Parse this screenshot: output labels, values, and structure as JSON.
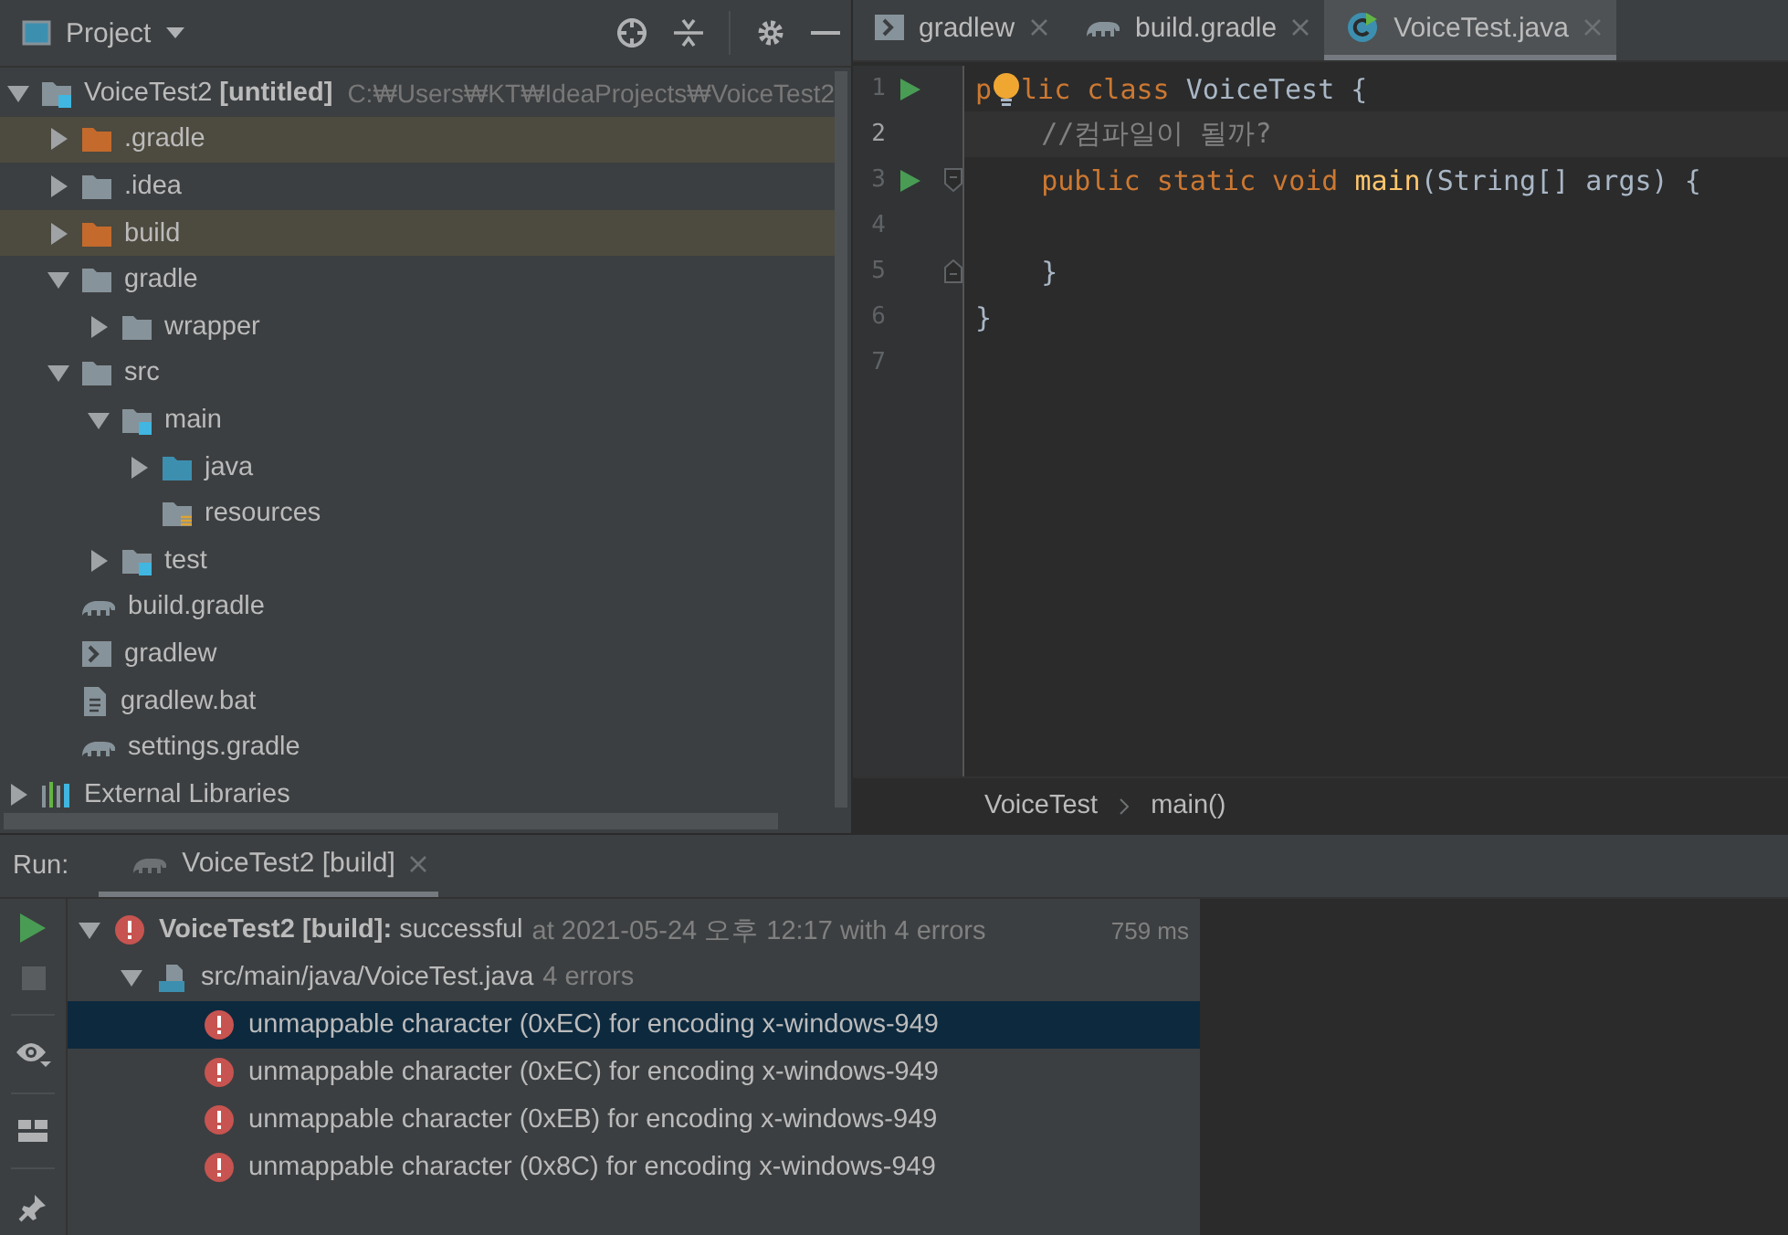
{
  "project_panel": {
    "title": "Project",
    "tree": [
      {
        "label": "VoiceTest2 **[untitled]**",
        "path": "C:₩Users₩KT₩IdeaProjects₩VoiceTest2",
        "kind": "module",
        "expanded": true,
        "children": [
          {
            "label": ".gradle",
            "kind": "excluded",
            "expanded": false
          },
          {
            "label": ".idea",
            "kind": "folder",
            "expanded": false
          },
          {
            "label": "build",
            "kind": "excluded",
            "expanded": false
          },
          {
            "label": "gradle",
            "kind": "folder",
            "expanded": true,
            "children": [
              {
                "label": "wrapper",
                "kind": "folder",
                "expanded": false
              }
            ]
          },
          {
            "label": "src",
            "kind": "folder",
            "expanded": true,
            "children": [
              {
                "label": "main",
                "kind": "module",
                "expanded": true,
                "children": [
                  {
                    "label": "java",
                    "kind": "source",
                    "expanded": false
                  },
                  {
                    "label": "resources",
                    "kind": "resources"
                  }
                ]
              },
              {
                "label": "test",
                "kind": "module",
                "expanded": false
              }
            ]
          },
          {
            "label": "build.gradle",
            "kind": "gradle"
          },
          {
            "label": "gradlew",
            "kind": "script"
          },
          {
            "label": "gradlew.bat",
            "kind": "text"
          },
          {
            "label": "settings.gradle",
            "kind": "gradle"
          }
        ]
      },
      {
        "label": "External Libraries",
        "kind": "libraries",
        "expanded": false
      }
    ]
  },
  "editor": {
    "tabs": [
      {
        "label": "gradlew",
        "kind": "script",
        "selected": false
      },
      {
        "label": "build.gradle",
        "kind": "gradle",
        "selected": false
      },
      {
        "label": "VoiceTest.java",
        "kind": "class",
        "selected": true
      }
    ],
    "lines": [
      {
        "number": "1",
        "run": true,
        "current": false,
        "tokens": [
          {
            "text": "p",
            "kind": "keyword"
          },
          {
            "kind": "bulb"
          },
          {
            "text": "lic class ",
            "kind": "keyword"
          },
          {
            "text": "VoiceTest {",
            "kind": "plain"
          }
        ]
      },
      {
        "number": "2",
        "run": false,
        "current": true,
        "tokens": [
          {
            "text": "    //컴파일이 될까?",
            "kind": "comment"
          }
        ]
      },
      {
        "number": "3",
        "run": true,
        "fold_start": true,
        "current": false,
        "tokens": [
          {
            "text": "    public static void ",
            "kind": "keyword"
          },
          {
            "text": "main",
            "kind": "method"
          },
          {
            "text": "(String[] args) {",
            "kind": "plain"
          }
        ]
      },
      {
        "number": "4",
        "run": false,
        "current": false
      },
      {
        "number": "5",
        "run": false,
        "fold_end": true,
        "current": false,
        "tokens": [
          {
            "text": "    }",
            "kind": "plain"
          }
        ]
      },
      {
        "number": "6",
        "run": false,
        "current": false,
        "tokens": [
          {
            "text": "}",
            "kind": "plain"
          }
        ]
      },
      {
        "number": "7",
        "run": false,
        "current": false
      }
    ],
    "breadcrumbs": [
      "VoiceTest",
      "main()"
    ]
  },
  "run_panel": {
    "label": "Run:",
    "tab": {
      "label": "VoiceTest2 [build]"
    },
    "tree": [
      {
        "label": "**VoiceTest2 [build]:** successful",
        "detail": "at 2021-05-24 오후 12:17 with 4 errors",
        "time": "759 ms",
        "kind": "error",
        "expanded": true,
        "selected": false,
        "children": [
          {
            "label": "src/main/java/VoiceTest.java",
            "detail": "4 errors",
            "kind": "file",
            "expanded": true,
            "selected": false,
            "children": [
              {
                "label": "unmappable character (0xEC) for encoding x-windows-949",
                "kind": "error",
                "selected": true
              },
              {
                "label": "unmappable character (0xEC) for encoding x-windows-949",
                "kind": "error",
                "selected": false
              },
              {
                "label": "unmappable character (0xEB) for encoding x-windows-949",
                "kind": "error",
                "selected": false
              },
              {
                "label": "unmappable character (0x8C) for encoding x-windows-949",
                "kind": "error",
                "selected": false
              }
            ]
          }
        ]
      }
    ]
  }
}
